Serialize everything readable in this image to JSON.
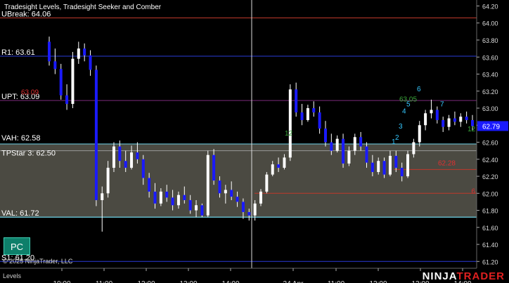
{
  "indicator_title": "Tradesight Levels, Tradesight Seeker and Comber",
  "copyright": "© 2025 NinjaTrader, LLC",
  "bottom_tab": "Levels",
  "brand": {
    "part1": "NINJA",
    "part2": "TRADER"
  },
  "pc_button": "PC",
  "colors": {
    "background": "#000000",
    "up_candle": "#ffffff",
    "down_candle": "#1a1aff",
    "value_area_fill": "#4b4a42",
    "value_area_edge": "#6fd3e8",
    "r1_line": "#2a3bd8",
    "s1_line": "#2a3bd8",
    "ubreak_line": "#c0392b",
    "upt_line": "#7a2a7a",
    "target_line": "#c0392b",
    "seeker_green": "#3aa83a",
    "comber_cyan": "#35c8ff",
    "price_tag": "#1a1aff",
    "brand_red": "#e02020"
  },
  "chart_data": {
    "type": "candlestick",
    "y_axis_ticks": [
      "64.20",
      "64.00",
      "63.80",
      "63.60",
      "63.40",
      "63.20",
      "63.00",
      "62.80",
      "62.60",
      "62.40",
      "62.20",
      "62.00",
      "61.80",
      "61.60",
      "61.40",
      "61.20"
    ],
    "ylim": [
      61.12,
      64.27
    ],
    "x_axis_ticks": [
      "10:00",
      "11:00",
      "12:00",
      "13:00",
      "14:00",
      "24 Apr",
      "11:00",
      "12:00",
      "13:00",
      "14:00"
    ],
    "last_price": "62.79",
    "levels": [
      {
        "label": "UBreak: 64.06",
        "value": 64.06,
        "style": "ubreak"
      },
      {
        "label": "R1: 63.61",
        "value": 63.61,
        "style": "r1"
      },
      {
        "label": "UPT: 63.09",
        "value": 63.09,
        "style": "upt"
      },
      {
        "label": "VAH: 62.58",
        "value": 62.58,
        "style": "vah"
      },
      {
        "label": "TPStar 3: 62.50",
        "value": 62.5,
        "style": "tpstar"
      },
      {
        "label": "VAL: 61.72",
        "value": 61.72,
        "style": "val"
      },
      {
        "label": "S1: 61.20",
        "value": 61.2,
        "style": "s1"
      }
    ],
    "value_area": {
      "high": 62.58,
      "low": 61.72
    },
    "annotations": [
      {
        "text": "63.09",
        "value": 63.16,
        "color": "red"
      },
      {
        "text": "62.28",
        "value": 62.33,
        "color": "red"
      },
      {
        "text": "6",
        "value": 62.0,
        "color": "red"
      },
      {
        "text": "63.05",
        "value": 63.08,
        "color": "green"
      },
      {
        "text": "6",
        "value": 63.2,
        "color": "cyan"
      },
      {
        "text": "7",
        "value": 63.02,
        "color": "cyan"
      },
      {
        "text": "5",
        "value": 63.02,
        "color": "cyan"
      },
      {
        "text": "4",
        "value": 62.94,
        "color": "cyan"
      },
      {
        "text": "3",
        "value": 62.76,
        "color": "cyan"
      },
      {
        "text": "2",
        "value": 62.63,
        "color": "cyan"
      },
      {
        "text": "1",
        "value": 62.58,
        "color": "cyan"
      },
      {
        "text": "12",
        "value": 62.73,
        "color": "green"
      },
      {
        "text": "12",
        "value": 62.68,
        "color": "green"
      }
    ],
    "candles": [
      [
        63.78,
        63.84,
        63.5,
        63.55
      ],
      [
        63.55,
        63.7,
        63.4,
        63.46
      ],
      [
        63.46,
        63.52,
        63.1,
        63.15
      ],
      [
        63.15,
        63.28,
        62.98,
        63.05
      ],
      [
        63.05,
        63.66,
        63.0,
        63.58
      ],
      [
        63.58,
        63.78,
        63.52,
        63.7
      ],
      [
        63.7,
        63.76,
        63.55,
        63.62
      ],
      [
        63.62,
        63.68,
        63.38,
        63.45
      ],
      [
        63.45,
        63.5,
        61.85,
        61.92
      ],
      [
        61.92,
        62.08,
        61.55,
        62.0
      ],
      [
        62.0,
        62.38,
        61.95,
        62.3
      ],
      [
        62.3,
        62.6,
        62.25,
        62.55
      ],
      [
        62.55,
        62.62,
        62.3,
        62.38
      ],
      [
        62.38,
        62.5,
        62.25,
        62.3
      ],
      [
        62.3,
        62.56,
        62.28,
        62.48
      ],
      [
        62.48,
        62.6,
        62.35,
        62.4
      ],
      [
        62.4,
        62.45,
        62.1,
        62.18
      ],
      [
        62.18,
        62.24,
        61.95,
        62.02
      ],
      [
        62.02,
        62.12,
        61.82,
        61.88
      ],
      [
        61.88,
        62.06,
        61.85,
        62.02
      ],
      [
        62.02,
        62.1,
        61.9,
        61.95
      ],
      [
        61.95,
        62.04,
        61.8,
        61.86
      ],
      [
        61.86,
        62.02,
        61.82,
        61.98
      ],
      [
        61.98,
        62.08,
        61.88,
        61.92
      ],
      [
        61.92,
        61.98,
        61.76,
        61.8
      ],
      [
        61.8,
        61.92,
        61.72,
        61.86
      ],
      [
        61.86,
        61.88,
        61.72,
        61.74
      ],
      [
        61.74,
        62.5,
        61.72,
        62.45
      ],
      [
        62.45,
        62.52,
        62.1,
        62.15
      ],
      [
        62.15,
        62.2,
        61.95,
        62.0
      ],
      [
        62.0,
        62.1,
        61.88,
        62.04
      ],
      [
        62.04,
        62.14,
        61.92,
        61.96
      ],
      [
        61.96,
        62.02,
        61.84,
        61.9
      ],
      [
        61.9,
        61.94,
        61.7,
        61.78
      ],
      [
        61.78,
        61.82,
        61.68,
        61.74
      ],
      [
        61.74,
        61.92,
        61.68,
        61.88
      ],
      [
        61.88,
        62.05,
        61.85,
        62.02
      ],
      [
        62.02,
        62.25,
        62.0,
        62.22
      ],
      [
        62.22,
        62.38,
        62.2,
        62.34
      ],
      [
        62.34,
        62.42,
        62.25,
        62.3
      ],
      [
        62.3,
        62.46,
        62.28,
        62.42
      ],
      [
        62.42,
        63.28,
        62.38,
        63.22
      ],
      [
        63.22,
        63.3,
        62.9,
        62.95
      ],
      [
        62.95,
        63.05,
        62.8,
        62.86
      ],
      [
        62.86,
        63.04,
        62.84,
        63.0
      ],
      [
        63.0,
        63.08,
        62.9,
        62.95
      ],
      [
        62.95,
        63.02,
        62.7,
        62.76
      ],
      [
        62.76,
        62.85,
        62.55,
        62.6
      ],
      [
        62.6,
        62.7,
        62.45,
        62.5
      ],
      [
        62.5,
        62.68,
        62.48,
        62.64
      ],
      [
        62.64,
        62.7,
        62.3,
        62.35
      ],
      [
        62.35,
        62.55,
        62.32,
        62.5
      ],
      [
        62.5,
        62.7,
        62.45,
        62.66
      ],
      [
        62.66,
        62.72,
        62.5,
        62.55
      ],
      [
        62.55,
        62.6,
        62.3,
        62.36
      ],
      [
        62.36,
        62.45,
        62.2,
        62.25
      ],
      [
        62.25,
        62.42,
        62.22,
        62.38
      ],
      [
        62.38,
        62.42,
        62.18,
        62.22
      ],
      [
        62.22,
        62.5,
        62.2,
        62.44
      ],
      [
        62.44,
        62.5,
        62.25,
        62.3
      ],
      [
        62.3,
        62.36,
        62.14,
        62.2
      ],
      [
        62.2,
        62.5,
        62.18,
        62.46
      ],
      [
        62.46,
        62.64,
        62.42,
        62.6
      ],
      [
        62.6,
        62.85,
        62.55,
        62.8
      ],
      [
        62.8,
        62.98,
        62.74,
        62.94
      ],
      [
        62.94,
        63.1,
        62.88,
        62.98
      ],
      [
        62.98,
        63.02,
        62.82,
        62.86
      ],
      [
        62.86,
        62.9,
        62.72,
        62.78
      ],
      [
        62.78,
        62.92,
        62.74,
        62.88
      ],
      [
        62.88,
        62.96,
        62.8,
        62.84
      ],
      [
        62.84,
        62.94,
        62.78,
        62.9
      ],
      [
        62.9,
        62.96,
        62.82,
        62.86
      ],
      [
        62.86,
        62.92,
        62.74,
        62.79
      ]
    ]
  }
}
